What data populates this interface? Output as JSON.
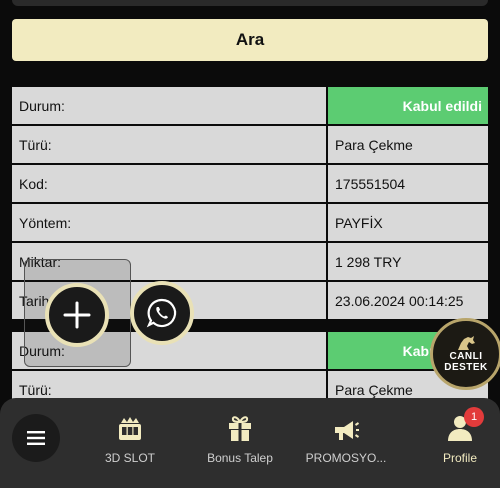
{
  "search": {
    "button_label": "Ara"
  },
  "transactions": [
    {
      "rows": [
        {
          "label": "Durum:",
          "value": "Kabul edildi",
          "status": true
        },
        {
          "label": "Türü:",
          "value": "Para Çekme"
        },
        {
          "label": "Kod:",
          "value": "175551504"
        },
        {
          "label": "Yöntem:",
          "value": "PAYFİX"
        },
        {
          "label": "Miktar:",
          "value": "1 298 TRY"
        },
        {
          "label": "Tarih:",
          "value": "23.06.2024 00:14:25"
        }
      ]
    },
    {
      "rows": [
        {
          "label": "Durum:",
          "value": "Kabul edildi",
          "status": true
        },
        {
          "label": "Türü:",
          "value": "Para Çekme"
        }
      ]
    }
  ],
  "live_support": {
    "line1": "CANLI",
    "line2": "DESTEK"
  },
  "bottom_nav": {
    "items": [
      {
        "label": "3D SLOT",
        "icon": "slot-machine-icon"
      },
      {
        "label": "Bonus Talep",
        "icon": "gift-icon"
      },
      {
        "label": "PROMOSYO...",
        "icon": "megaphone-icon"
      },
      {
        "label": "Profile",
        "icon": "user-icon",
        "badge": "1"
      }
    ]
  },
  "colors": {
    "accent": "#f2ebc0",
    "status_green": "#5ccc72",
    "cell_bg": "#d9d9d9",
    "badge_red": "#e23b3b"
  }
}
